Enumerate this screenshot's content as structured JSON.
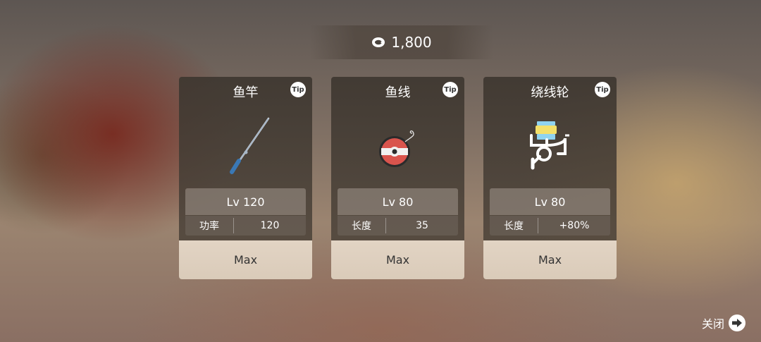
{
  "currency": {
    "amount": "1,800",
    "icon": "fish-coin-icon"
  },
  "cards": [
    {
      "title": "鱼竿",
      "tip": "Tip",
      "icon": "fishing-rod-icon",
      "level": "Lv 120",
      "stat_label": "功率",
      "stat_value": "120",
      "button": "Max"
    },
    {
      "title": "鱼线",
      "tip": "Tip",
      "icon": "fishing-line-spool-icon",
      "level": "Lv 80",
      "stat_label": "长度",
      "stat_value": "35",
      "button": "Max"
    },
    {
      "title": "绕线轮",
      "tip": "Tip",
      "icon": "fishing-reel-icon",
      "level": "Lv 80",
      "stat_label": "长度",
      "stat_value": "+80%",
      "button": "Max"
    }
  ],
  "close": {
    "label": "关闭",
    "icon": "arrow-right-circle-icon"
  },
  "colors": {
    "button_bg": "#e2d4c4",
    "card_bg": "#3e3730"
  }
}
